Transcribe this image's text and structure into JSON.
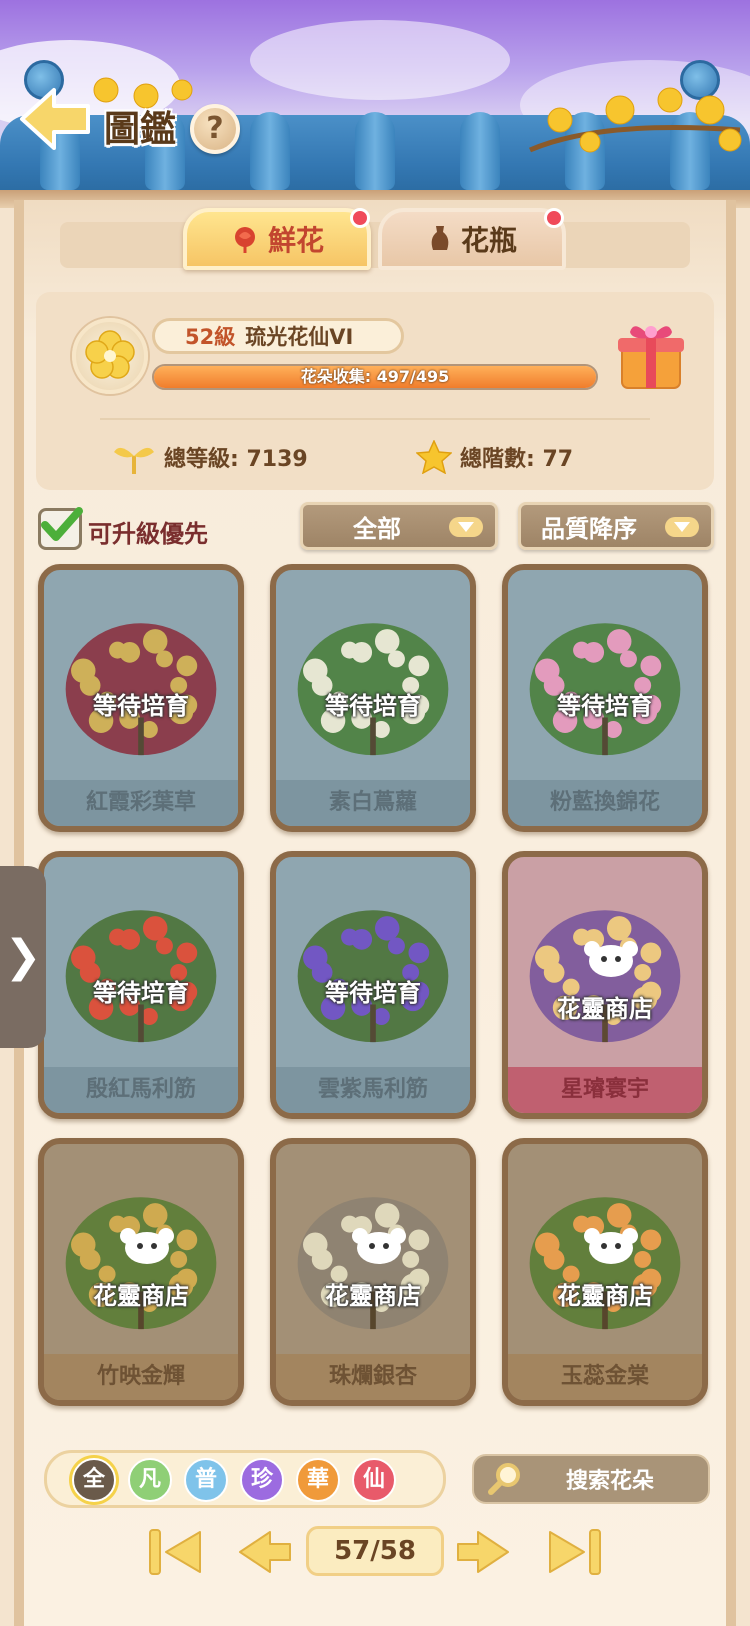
{
  "header": {
    "title": "圖鑑",
    "help_icon": "?"
  },
  "tabs": [
    {
      "label": "鮮花",
      "active": true,
      "icon": "rose-icon"
    },
    {
      "label": "花瓶",
      "active": false,
      "icon": "vase-icon"
    }
  ],
  "stats": {
    "level": "52級",
    "rank_name": "琉光花仙VI",
    "collection_label": "花朵收集: 497/495",
    "total_level_label": "總等級: 7139",
    "total_stage_label": "總階數: 77"
  },
  "filters": {
    "upgrade_first_label": "可升級優先",
    "upgrade_first_checked": true,
    "category_value": "全部",
    "sort_value": "品質降序"
  },
  "cards": [
    {
      "name": "紅霞彩葉草",
      "status": "等待培育",
      "type": "wait"
    },
    {
      "name": "素白蔦蘿",
      "status": "等待培育",
      "type": "wait"
    },
    {
      "name": "粉藍換錦花",
      "status": "等待培育",
      "type": "wait"
    },
    {
      "name": "殷紅馬利筋",
      "status": "等待培育",
      "type": "wait"
    },
    {
      "name": "雲紫馬利筋",
      "status": "等待培育",
      "type": "wait"
    },
    {
      "name": "星璿寰宇",
      "status": "花靈商店",
      "type": "shop-red"
    },
    {
      "name": "竹映金輝",
      "status": "花靈商店",
      "type": "shop-blue"
    },
    {
      "name": "珠爛銀杏",
      "status": "花靈商店",
      "type": "shop-blue"
    },
    {
      "name": "玉蕊金棠",
      "status": "花靈商店",
      "type": "shop-blue"
    }
  ],
  "rarity": [
    {
      "label": "全",
      "color": "#6a5a4a"
    },
    {
      "label": "凡",
      "color": "#8fcf76"
    },
    {
      "label": "普",
      "color": "#7fc3ea"
    },
    {
      "label": "珍",
      "color": "#9c6be0"
    },
    {
      "label": "華",
      "color": "#f09a3a"
    },
    {
      "label": "仙",
      "color": "#e85a6a"
    }
  ],
  "search": {
    "placeholder": "搜索花朵"
  },
  "pagination": {
    "label": "57/58"
  },
  "side_handle": {
    "glyph": "❯"
  }
}
